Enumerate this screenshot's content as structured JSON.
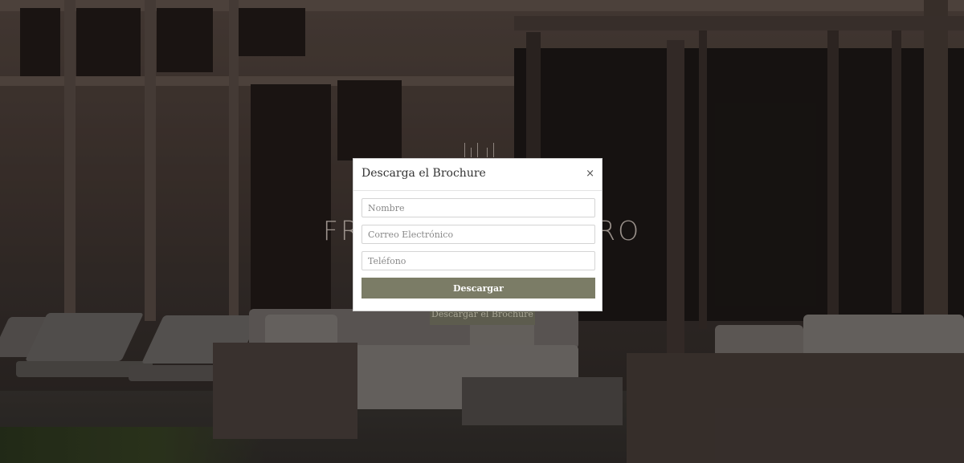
{
  "hero": {
    "title": "FRANCISCO ROMERO",
    "button_label": "Descargar el Brochure"
  },
  "modal": {
    "title": "Descarga el Brochure",
    "close_label": "×",
    "fields": {
      "name_placeholder": "Nombre",
      "email_placeholder": "Correo Electrónico",
      "phone_placeholder": "Teléfono"
    },
    "submit_label": "Descargar"
  },
  "colors": {
    "submit_bg": "#7b7c66",
    "overlay": "rgba(0,0,0,0.28)"
  }
}
